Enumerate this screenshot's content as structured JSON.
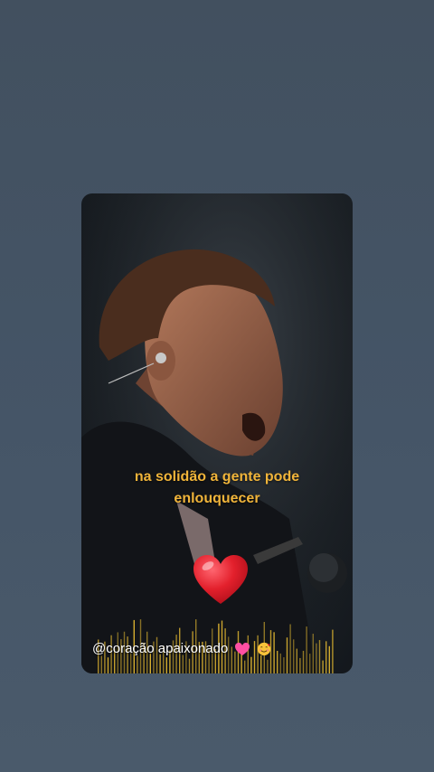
{
  "video": {
    "lyric_line1": "na solidão a gente pode",
    "lyric_line2": "enlouquecer",
    "caption": "@coração apaixonado",
    "caption_emojis": [
      "pink-heart-icon",
      "smiling-face-with-hearts-icon"
    ],
    "heart_sticker": "red-heart-icon"
  },
  "colors": {
    "background": "#455567",
    "lyric_text": "#f0b43a",
    "caption_text": "#ffffff",
    "heart": "#e0232f",
    "bars": "#d8b030"
  }
}
